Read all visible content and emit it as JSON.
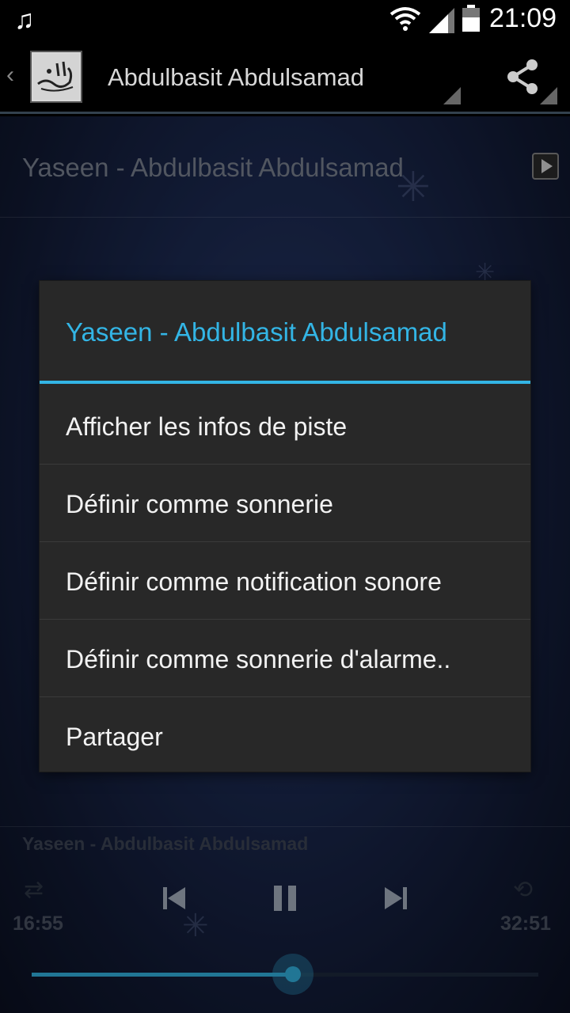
{
  "status_bar": {
    "time": "21:09",
    "icons": [
      "music-note-icon",
      "wifi-icon",
      "signal-icon",
      "battery-icon"
    ]
  },
  "action_bar": {
    "back_icon": "back-chevron-icon",
    "app_icon": "bismillah-calligraphy-logo",
    "title": "Abdulbasit Abdulsamad",
    "share_icon": "share-icon"
  },
  "track": {
    "title": "Yaseen - Abdulbasit Abdulsamad",
    "play_icon": "play-icon"
  },
  "dialog": {
    "title": "Yaseen - Abdulbasit Abdulsamad",
    "items": [
      {
        "label": "Afficher les infos de piste"
      },
      {
        "label": "Définir comme sonnerie"
      },
      {
        "label": "Définir comme notification sonore"
      },
      {
        "label": "Définir comme sonnerie d'alarme.."
      },
      {
        "label": "Partager"
      }
    ]
  },
  "player": {
    "now_playing": "Yaseen - Abdulbasit Abdulsamad",
    "elapsed": "16:55",
    "duration": "32:51",
    "progress_fraction": 0.515,
    "controls": [
      "shuffle-icon",
      "previous-icon",
      "pause-icon",
      "next-icon",
      "repeat-icon"
    ]
  },
  "colors": {
    "accent": "#33b5e5",
    "dialog_bg": "#282828",
    "status_bg": "#000000"
  }
}
